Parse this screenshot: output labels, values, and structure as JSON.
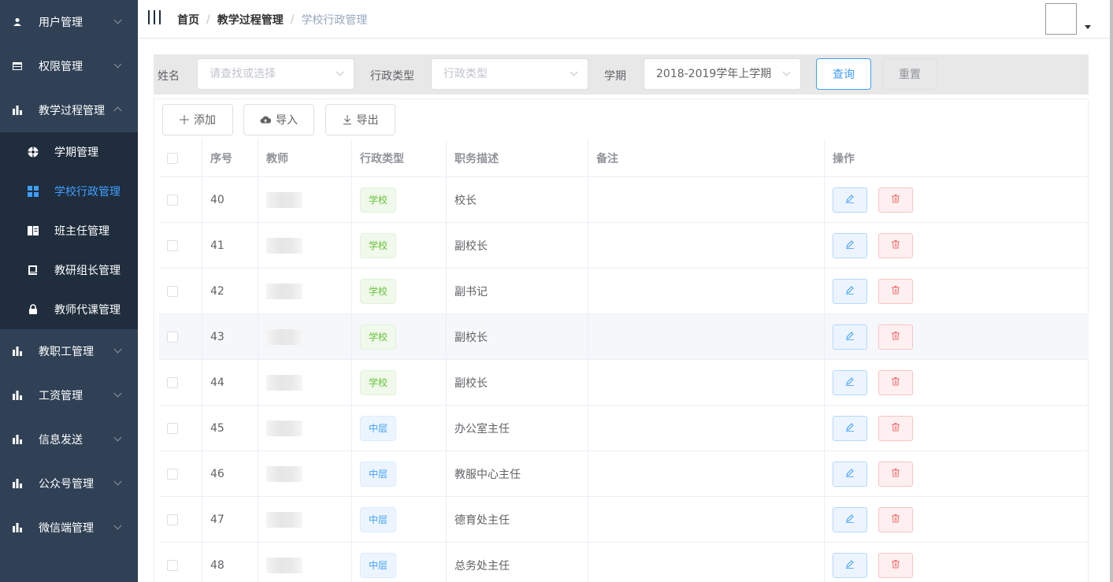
{
  "sidebar": {
    "items": [
      {
        "label": "用户管理",
        "icon": "user-icon"
      },
      {
        "label": "权限管理",
        "icon": "table-icon"
      },
      {
        "label": "教学过程管理",
        "icon": "chart-icon"
      }
    ],
    "submenu": [
      {
        "label": "学期管理",
        "icon": "compass-icon"
      },
      {
        "label": "学校行政管理",
        "icon": "grid-icon"
      },
      {
        "label": "班主任管理",
        "icon": "book-icon"
      },
      {
        "label": "教研组长管理",
        "icon": "note-icon"
      },
      {
        "label": "教师代课管理",
        "icon": "lock-icon"
      }
    ],
    "items_after": [
      {
        "label": "教职工管理",
        "icon": "chart-icon"
      },
      {
        "label": "工资管理",
        "icon": "chart-icon"
      },
      {
        "label": "信息发送",
        "icon": "chart-icon"
      },
      {
        "label": "公众号管理",
        "icon": "chart-icon"
      },
      {
        "label": "微信端管理",
        "icon": "chart-icon"
      }
    ],
    "active_color": "#409eff",
    "bg_color": "#304156",
    "submenu_bg_color": "#1f2d3d"
  },
  "header": {
    "breadcrumb": [
      "首页",
      "教学过程管理",
      "学校行政管理"
    ],
    "separator": "/"
  },
  "filter": {
    "name_label": "姓名",
    "name_placeholder": "请查找或选择",
    "type_label": "行政类型",
    "type_placeholder": "行政类型",
    "term_label": "学期",
    "term_value": "2018-2019学年上学期",
    "query_label": "查询",
    "reset_label": "重置"
  },
  "toolbar": {
    "add_label": "添加",
    "import_label": "导入",
    "export_label": "导出"
  },
  "table": {
    "columns": [
      "序号",
      "教师",
      "行政类型",
      "职务描述",
      "备注",
      "操作"
    ],
    "rows": [
      {
        "id": "40",
        "teacher": "",
        "type": "学校",
        "type_color": "green",
        "duty": "校长",
        "note": ""
      },
      {
        "id": "41",
        "teacher": "",
        "type": "学校",
        "type_color": "green",
        "duty": "副校长",
        "note": ""
      },
      {
        "id": "42",
        "teacher": "",
        "type": "学校",
        "type_color": "green",
        "duty": "副书记",
        "note": ""
      },
      {
        "id": "43",
        "teacher": "",
        "type": "学校",
        "type_color": "green",
        "duty": "副校长",
        "note": ""
      },
      {
        "id": "44",
        "teacher": "",
        "type": "学校",
        "type_color": "green",
        "duty": "副校长",
        "note": ""
      },
      {
        "id": "45",
        "teacher": "",
        "type": "中层",
        "type_color": "blue",
        "duty": "办公室主任",
        "note": ""
      },
      {
        "id": "46",
        "teacher": "",
        "type": "中层",
        "type_color": "blue",
        "duty": "教服中心主任",
        "note": ""
      },
      {
        "id": "47",
        "teacher": "",
        "type": "中层",
        "type_color": "blue",
        "duty": "德育处主任",
        "note": ""
      },
      {
        "id": "48",
        "teacher": "",
        "type": "中层",
        "type_color": "blue",
        "duty": "总务处主任",
        "note": ""
      }
    ],
    "hover_row": "43",
    "edit_icon": "pencil-icon",
    "delete_icon": "trash-icon"
  }
}
